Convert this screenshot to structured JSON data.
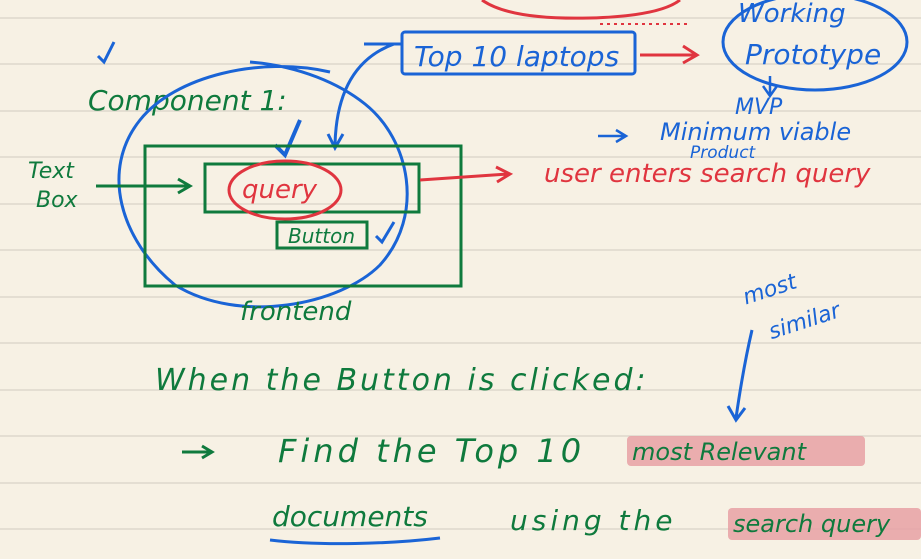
{
  "notes": {
    "top_label": "Top 10 laptops",
    "working_prototype_line1": "Working",
    "working_prototype_line2": "Prototype",
    "mvp": "MVP",
    "mvp_expansion_line1": "Minimum viable",
    "mvp_expansion_line2": "Product",
    "component_title": "Component 1:",
    "textbox_label_line1": "Text",
    "textbox_label_line2": "Box",
    "query_text": "query",
    "button_text": "Button",
    "user_action": "user enters search query",
    "frontend_label": "frontend",
    "most_similar_line1": "most",
    "most_similar_line2": "similar",
    "when_clicked": "When the Button is clicked:",
    "find_prefix": "Find the Top 10",
    "most_relevant": "most Relevant",
    "documents": "documents",
    "using_the": "using the",
    "search_query": "search query"
  },
  "colors": {
    "paper": "#f7f1e4",
    "rule_line": "#d8d2c6",
    "green": "#0f7a3d",
    "blue": "#1a64d6",
    "red": "#e0353f",
    "highlight": "#e8a1a4"
  }
}
